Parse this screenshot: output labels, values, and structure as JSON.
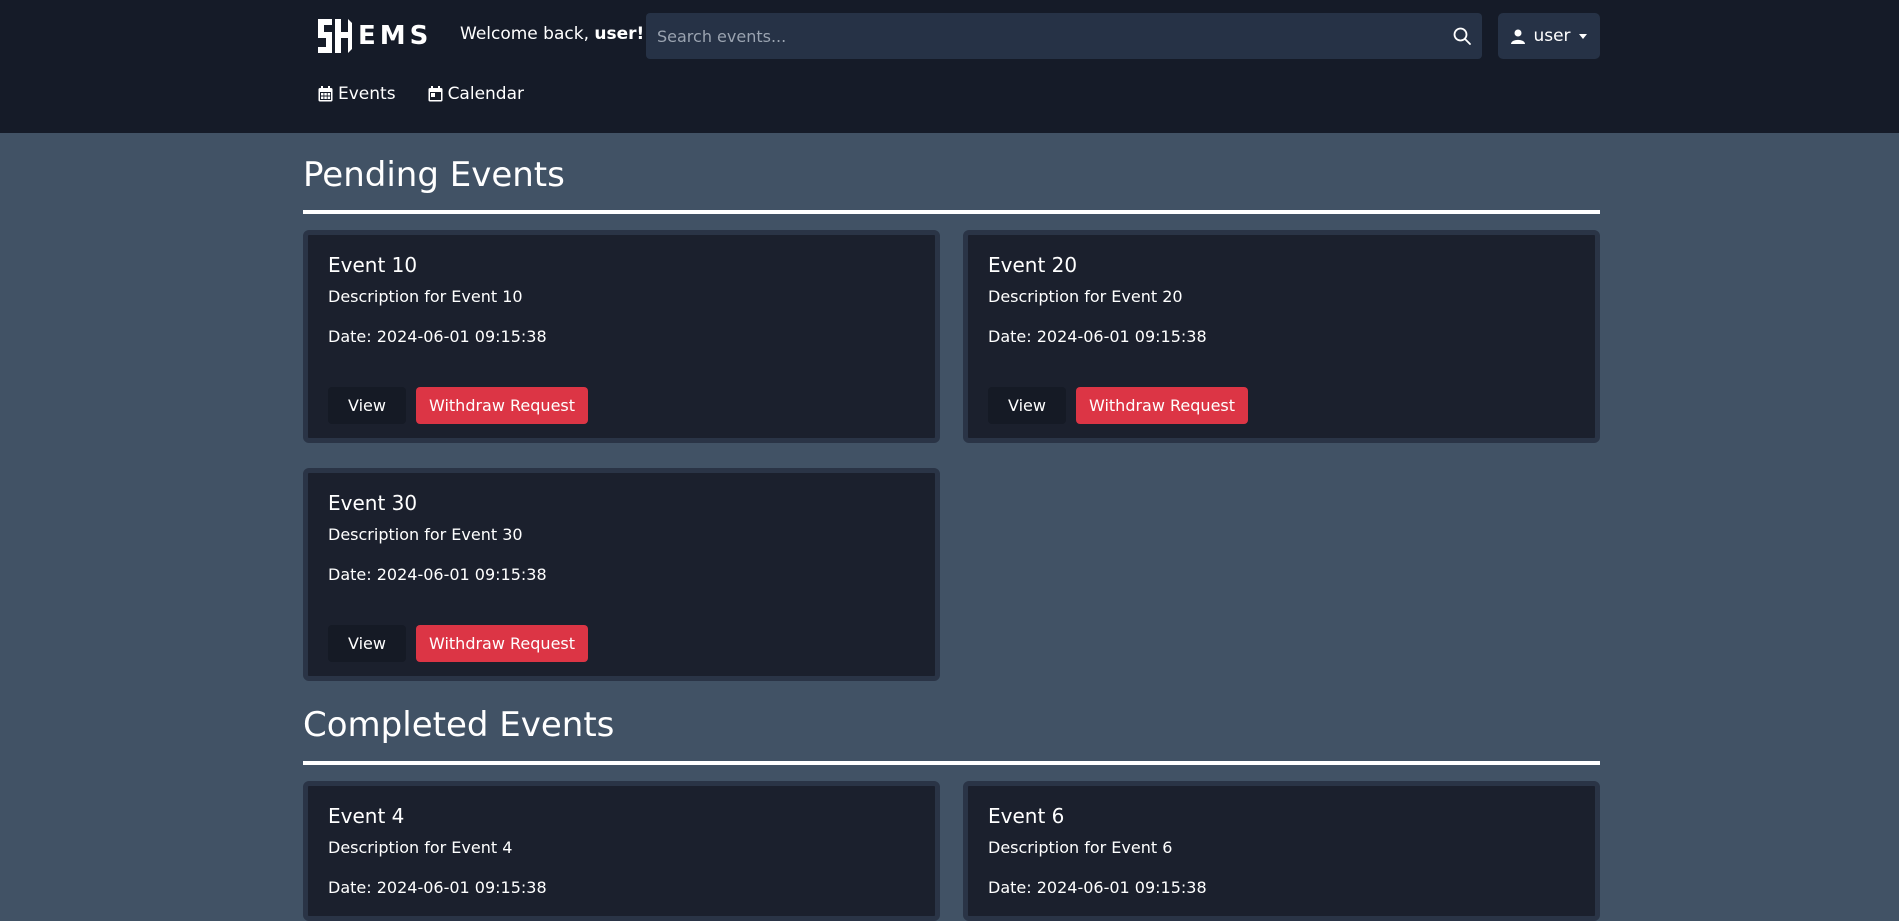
{
  "header": {
    "logo_text": "EMS",
    "welcome_prefix": "Welcome back, ",
    "welcome_user": "user!",
    "search_placeholder": "Search events...",
    "user_label": "user",
    "nav": [
      {
        "label": "Events",
        "icon": "calendar-grid-icon"
      },
      {
        "label": "Calendar",
        "icon": "calendar-day-icon"
      }
    ]
  },
  "pending": {
    "title": "Pending Events",
    "events": [
      {
        "title": "Event 10",
        "description": "Description for Event 10",
        "date": "Date: 2024-06-01 09:15:38",
        "view_label": "View",
        "withdraw_label": "Withdraw Request"
      },
      {
        "title": "Event 20",
        "description": "Description for Event 20",
        "date": "Date: 2024-06-01 09:15:38",
        "view_label": "View",
        "withdraw_label": "Withdraw Request"
      },
      {
        "title": "Event 30",
        "description": "Description for Event 30",
        "date": "Date: 2024-06-01 09:15:38",
        "view_label": "View",
        "withdraw_label": "Withdraw Request"
      }
    ]
  },
  "completed": {
    "title": "Completed Events",
    "events": [
      {
        "title": "Event 4",
        "description": "Description for Event 4",
        "date": "Date: 2024-06-01 09:15:38"
      },
      {
        "title": "Event 6",
        "description": "Description for Event 6",
        "date": "Date: 2024-06-01 09:15:38"
      }
    ]
  },
  "colors": {
    "page_bg": "#415265",
    "header_bg": "#151b28",
    "card_bg": "#1b202d",
    "danger": "#dc3545"
  }
}
